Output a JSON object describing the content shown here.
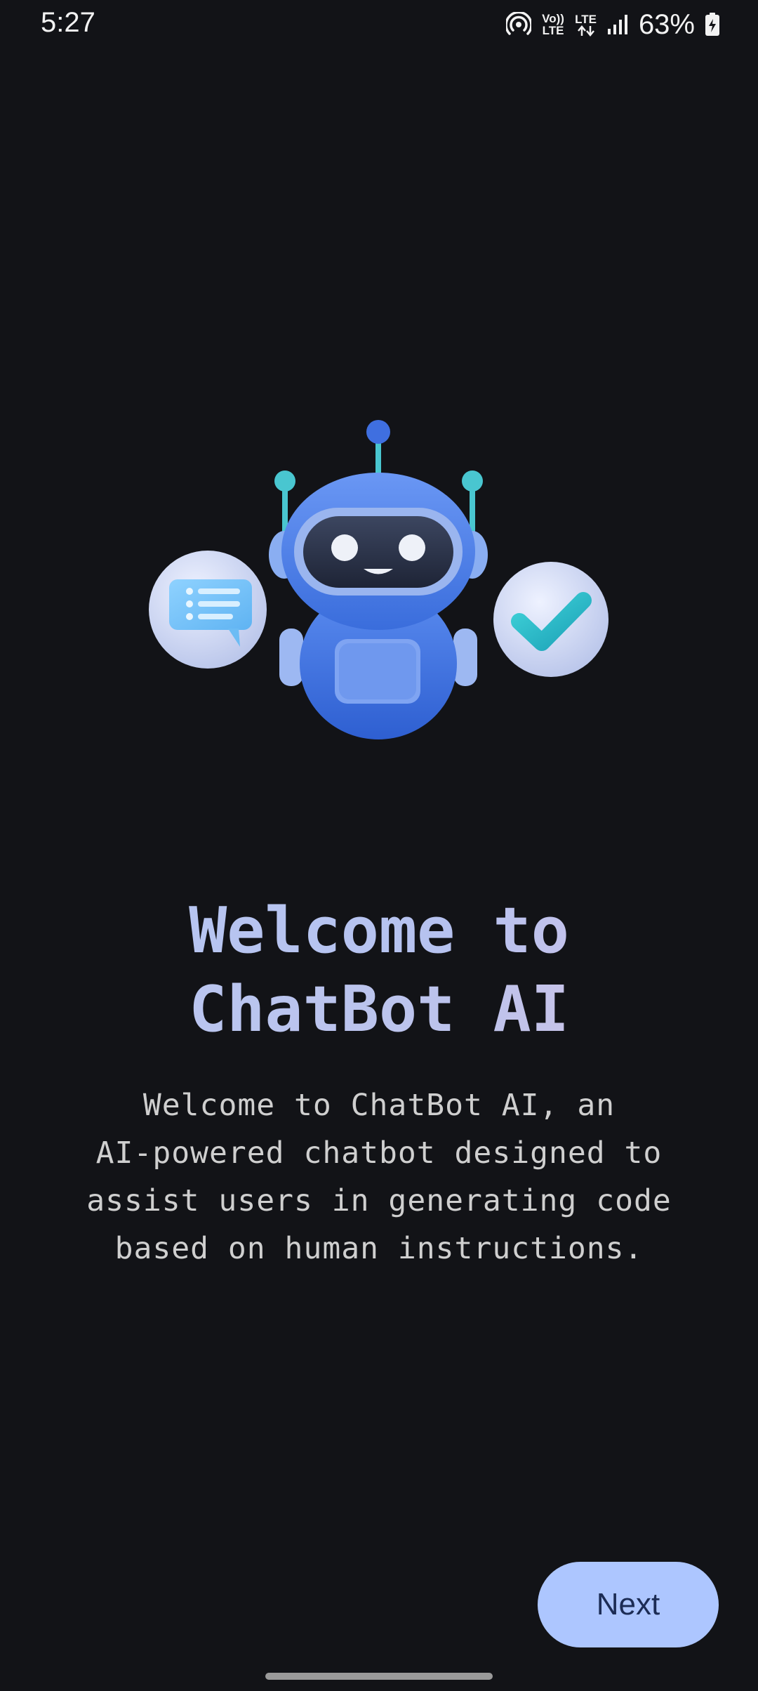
{
  "status_bar": {
    "time": "5:27",
    "volte_label": "Vo)) LTE",
    "lte_label": "LTE",
    "battery_percent": "63%"
  },
  "hero": {
    "robot_icon": "robot-icon",
    "chat_icon": "chat-bubble-icon",
    "check_icon": "check-icon"
  },
  "title": {
    "line1": "Welcome to",
    "line2": "ChatBot AI"
  },
  "description": {
    "line1": "Welcome to ChatBot AI, an",
    "line2": "AI-powered chatbot designed to",
    "line3": "assist users in generating code",
    "line4": "based on human instructions."
  },
  "actions": {
    "next_label": "Next"
  },
  "colors": {
    "background": "#121317",
    "button": "#adc6ff",
    "button_text": "#1c2c55",
    "accent_blue": "#3f73e0"
  }
}
